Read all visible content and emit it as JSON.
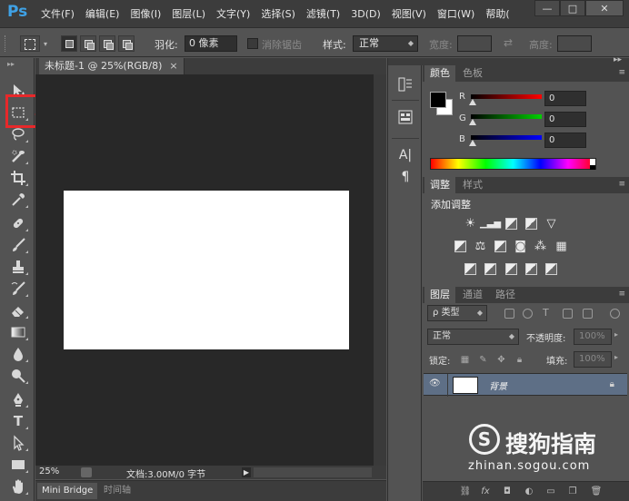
{
  "app": {
    "logo": "Ps",
    "menu": [
      "文件(F)",
      "编辑(E)",
      "图像(I)",
      "图层(L)",
      "文字(Y)",
      "选择(S)",
      "滤镜(T)",
      "3D(D)",
      "视图(V)",
      "窗口(W)",
      "帮助("
    ]
  },
  "options_bar": {
    "feather_label": "羽化:",
    "feather_value": "0 像素",
    "antialias_label": "消除锯齿",
    "style_label": "样式:",
    "style_value": "正常",
    "width_label": "宽度:",
    "height_label": "高度:"
  },
  "tools": [
    "move-tool",
    "rectangular-marquee-tool",
    "lasso-tool",
    "quick-selection-tool",
    "crop-tool",
    "eyedropper-tool",
    "spot-healing-brush-tool",
    "brush-tool",
    "clone-stamp-tool",
    "history-brush-tool",
    "eraser-tool",
    "gradient-tool",
    "blur-tool",
    "dodge-tool",
    "pen-tool",
    "type-tool",
    "path-selection-tool",
    "rectangle-tool",
    "hand-tool"
  ],
  "annotation": {
    "highlighted_tool": "rectangular-marquee-tool",
    "color": "#e8282a"
  },
  "document": {
    "tab_title": "未标题-1 @ 25%(RGB/8)",
    "tab_close": "×",
    "zoom": "25%",
    "doc_info": "文档:3.00M/0 字节"
  },
  "bottom_tabs": [
    "Mini Bridge",
    "时间轴"
  ],
  "color_panel": {
    "tabs": [
      "颜色",
      "色板"
    ],
    "channels": [
      {
        "label": "R",
        "value": "0",
        "gradient": "#ff0000"
      },
      {
        "label": "G",
        "value": "0",
        "gradient": "#00d000"
      },
      {
        "label": "B",
        "value": "0",
        "gradient": "#0000ff"
      }
    ],
    "foreground": "#000000",
    "background": "#ffffff"
  },
  "adjustments_panel": {
    "tabs": [
      "调整",
      "样式"
    ],
    "title": "添加调整"
  },
  "layers_panel": {
    "tabs": [
      "图层",
      "通道",
      "路径"
    ],
    "filter_kind": "ρ 类型",
    "blend_mode": "正常",
    "opacity_label": "不透明度:",
    "opacity_value": "100%",
    "lock_label": "锁定:",
    "fill_label": "填充:",
    "fill_value": "100%",
    "layers": [
      {
        "name": "背景",
        "visible": true,
        "locked": true
      }
    ]
  },
  "watermark": {
    "logo_glyph": "S",
    "brand": "搜狗指南",
    "url": "zhinan.sogou.com"
  }
}
